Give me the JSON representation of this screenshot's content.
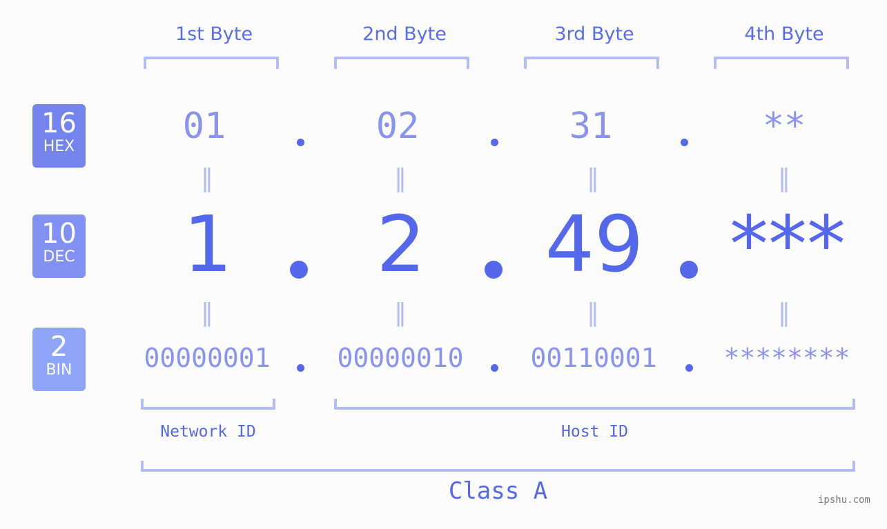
{
  "bytes": [
    {
      "header": "1st Byte",
      "hex": "01",
      "dec": "1",
      "bin": "00000001"
    },
    {
      "header": "2nd Byte",
      "hex": "02",
      "dec": "2",
      "bin": "00000010"
    },
    {
      "header": "3rd Byte",
      "hex": "31",
      "dec": "49",
      "bin": "00110001"
    },
    {
      "header": "4th Byte",
      "hex": "**",
      "dec": "***",
      "bin": "********"
    }
  ],
  "badges": {
    "hex": {
      "num": "16",
      "label": "HEX",
      "color": "#7583ec"
    },
    "dec": {
      "num": "10",
      "label": "DEC",
      "color": "#8290f1"
    },
    "bin": {
      "num": "2",
      "label": "BIN",
      "color": "#8fa5f8"
    }
  },
  "equals_glyph": "=",
  "parts": {
    "network": "Network ID",
    "host": "Host ID"
  },
  "class_label": "Class A",
  "watermark": "ipshu.com",
  "colors": {
    "accent": "#5567ea",
    "light": "#8a93ee",
    "bracket": "#b3bcf5",
    "background": "#fbfcfb"
  }
}
